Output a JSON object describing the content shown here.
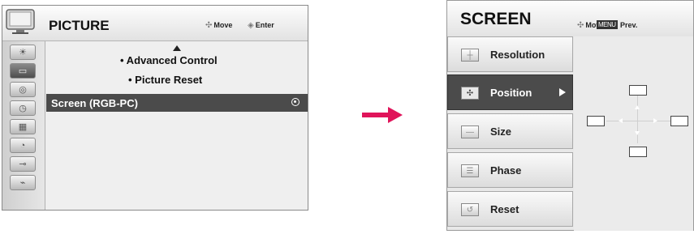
{
  "left_menu": {
    "title": "PICTURE",
    "hint_move": "Move",
    "hint_enter": "Enter",
    "options": [
      "• Advanced Control",
      "• Picture Reset"
    ],
    "selected_item": "Screen (RGB-PC)",
    "sidebar_icons": [
      "picture-icon",
      "audio-icon",
      "tv-icon",
      "disc-icon",
      "clock-icon",
      "lock-icon",
      "option-icon",
      "input-icon",
      "usb-icon"
    ]
  },
  "right_menu": {
    "title": "SCREEN",
    "hint_move": "Move",
    "menu_key": "MENU",
    "hint_prev": "Prev.",
    "items": [
      {
        "label": "Resolution",
        "icon": "resolution-icon",
        "selected": false
      },
      {
        "label": "Position",
        "icon": "position-icon",
        "selected": true
      },
      {
        "label": "Size",
        "icon": "size-icon",
        "selected": false
      },
      {
        "label": "Phase",
        "icon": "phase-icon",
        "selected": false
      },
      {
        "label": "Reset",
        "icon": "reset-icon",
        "selected": false
      }
    ]
  },
  "colors": {
    "arrow": "#e0145a",
    "selected_bg": "#4b4b4b",
    "panel_bg": "#ececec"
  }
}
